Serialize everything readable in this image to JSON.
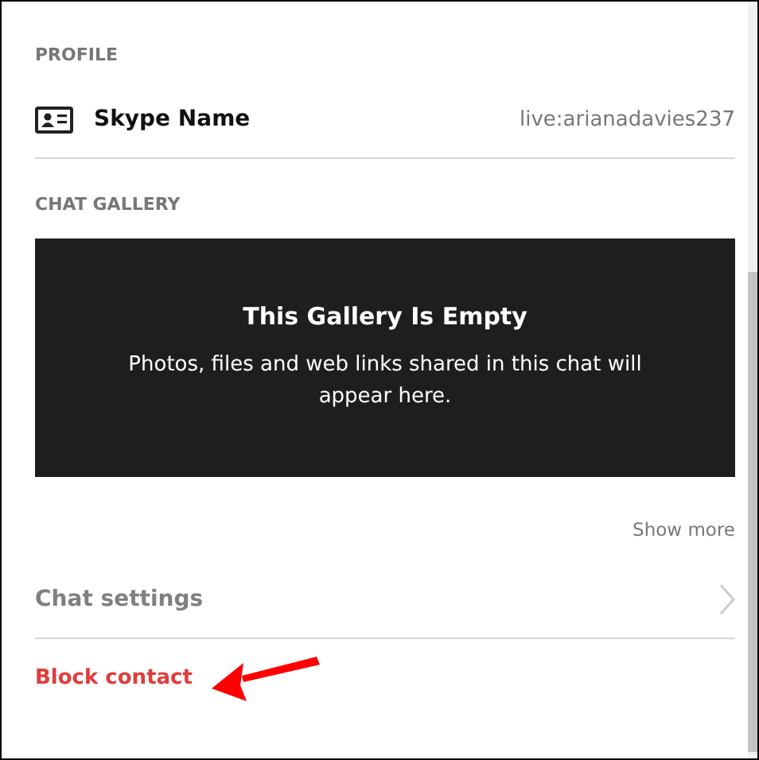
{
  "profile": {
    "heading": "PROFILE",
    "label": "Skype Name",
    "value": "live:arianadavies237"
  },
  "gallery": {
    "heading": "CHAT GALLERY",
    "title": "This Gallery Is Empty",
    "message": "Photos, files and web links shared in this chat will appear here.",
    "show_more": "Show more"
  },
  "chat_settings": {
    "label": "Chat settings"
  },
  "block_contact": {
    "label": "Block contact"
  }
}
